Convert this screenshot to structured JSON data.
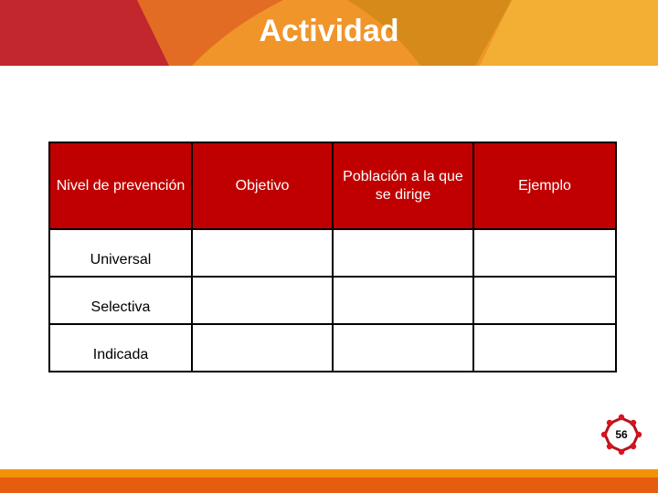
{
  "slide": {
    "title": "Actividad",
    "page_number": "56"
  },
  "table": {
    "headers": [
      "Nivel de prevención",
      "Objetivo",
      "Población a la que se dirige",
      "Ejemplo"
    ],
    "rows": [
      [
        "Universal",
        "",
        "",
        ""
      ],
      [
        "Selectiva",
        "",
        "",
        ""
      ],
      [
        "Indicada",
        "",
        "",
        ""
      ]
    ]
  },
  "colors": {
    "header_red": "#c00000",
    "banner_red": "#c1272d",
    "banner_orange": "#e36c24",
    "banner_light_orange": "#f0952a",
    "banner_gold": "#d58a1a",
    "banner_yellow": "#f3ae34",
    "footer_orange": "#f39207",
    "footer_dark_orange": "#e65d0f"
  },
  "icons": {
    "logo": "gear-molecule-icon"
  }
}
